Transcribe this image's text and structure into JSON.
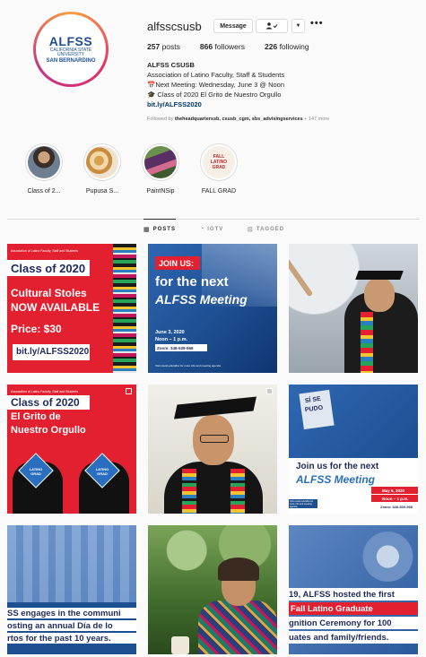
{
  "profile": {
    "username": "alfsscsusb",
    "message_label": "Message",
    "more_label": "•••",
    "logo": {
      "word": "ALFSS",
      "sub": "CALIFORNIA STATE UNIVERSITY",
      "sub2": "SAN BERNARDINO"
    },
    "stats": {
      "posts": "257",
      "posts_label": "posts",
      "followers": "866",
      "followers_label": "followers",
      "following": "226",
      "following_label": "following"
    },
    "bio": {
      "name": "ALFSS CSUSB",
      "line1": "Association of Latino Faculty, Staff & Students",
      "line2": "📅Next Meeting: Wednesday, June 3 @ Noon",
      "line3": "🎓 Class of 2020 El Grito de Nuestro Orgullo",
      "link": "bit.ly/ALFSS2020"
    },
    "followed_by": {
      "prefix": "Followed by ",
      "names": "theheadquarterssb, csusb_cgm, sbs_advisingservices",
      "suffix": " + 147 more"
    }
  },
  "highlights": [
    {
      "label": "Class of 2..."
    },
    {
      "label": "Pupusa S..."
    },
    {
      "label": "PaintNSip"
    },
    {
      "label": "FALL GRAD",
      "cover_text": "FALL LATINO GRAD"
    }
  ],
  "tabs": [
    {
      "label": "POSTS",
      "icon": "grid-icon"
    },
    {
      "label": "IGTV",
      "icon": "igtv-icon"
    },
    {
      "label": "TAGGED",
      "icon": "tagged-icon"
    }
  ],
  "posts": {
    "p1": {
      "header": "Association of Latino Faculty, Staff and Students",
      "title": "Class of 2020",
      "l1": "Cultural Stoles",
      "l2": "NOW AVAILABLE",
      "price": "Price: $30",
      "link": "bit.ly/ALFSS2020"
    },
    "p2": {
      "join": "JOIN US:",
      "l1": "for the next",
      "l2": "ALFSS Meeting",
      "date": "June 3, 2020",
      "time": "Noon – 1 p.m.",
      "zoom": "Zoom: 348-539-968",
      "foot": "Visit csusb.edu/alfss for more info and meeting agenda"
    },
    "p4": {
      "header": "Association of Latino Faculty, Staff and Students",
      "title": "Class of 2020",
      "l1": "El Grito de",
      "l2": "Nuestro Orgullo",
      "cap1": "LATINO GRAD",
      "cap2": "LATINO GRAD"
    },
    "p6": {
      "sign1": "SÍ SE",
      "sign2": "PUDO",
      "l1": "Join us for the next",
      "l2": "ALFSS Meeting",
      "date": "May 6, 2020",
      "time": "Noon – 1 p.m.",
      "zoom": "Zoom: 348-539-968",
      "foot": "Visit csusb.edu/alfss for more info and meeting agenda"
    },
    "p7": {
      "l1": "SS engages in the communi",
      "l2": "osting an annual Día de lo",
      "l3": "rtos for the past 10 years."
    },
    "p9": {
      "l1": "19, ALFSS hosted the first",
      "l2": "Fall Latino Graduate",
      "l3": "gnition Ceremony for 100",
      "l4": "uates and family/friends."
    }
  },
  "colors": {
    "brand_blue": "#1d4f91",
    "red": "#e0202f",
    "link": "#00376b",
    "gray_text": "#8e8e8e"
  }
}
